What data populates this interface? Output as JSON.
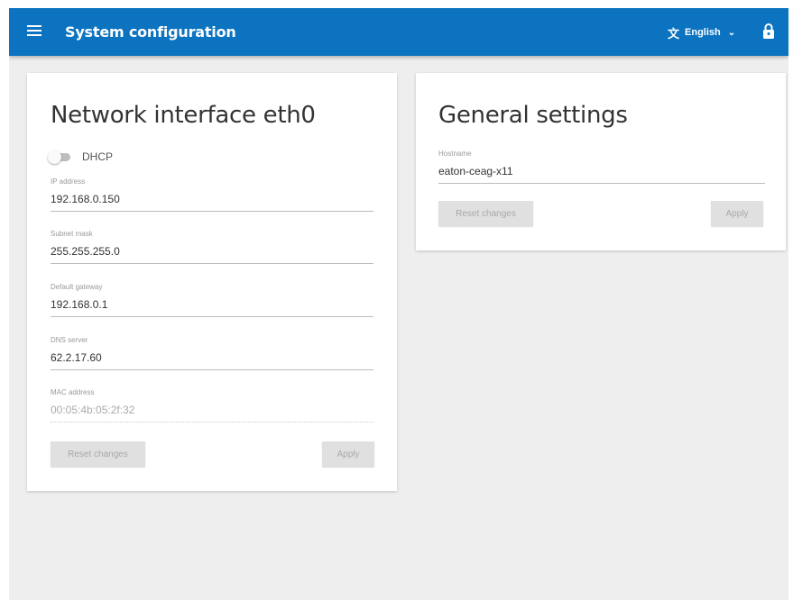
{
  "header": {
    "title": "System configuration",
    "language": "English",
    "language_icon": "translate-icon",
    "lock_icon": "lock-icon",
    "menu_icon": "menu-icon",
    "bar_color": "#0b73c0"
  },
  "network": {
    "title": "Network interface eth0",
    "dhcp_label": "DHCP",
    "dhcp_enabled": false,
    "fields": [
      {
        "label": "IP address",
        "value": "192.168.0.150"
      },
      {
        "label": "Subnet mask",
        "value": "255.255.255.0"
      },
      {
        "label": "Default gateway",
        "value": "192.168.0.1"
      },
      {
        "label": "DNS server",
        "value": "62.2.17.60"
      },
      {
        "label": "MAC address",
        "value": "00:05:4b:05:2f:32"
      }
    ],
    "reset_label": "Reset changes",
    "apply_label": "Apply"
  },
  "general": {
    "title": "General settings",
    "hostname_label": "Hostname",
    "hostname_value": "eaton-ceag-x11",
    "reset_label": "Reset changes",
    "apply_label": "Apply"
  }
}
